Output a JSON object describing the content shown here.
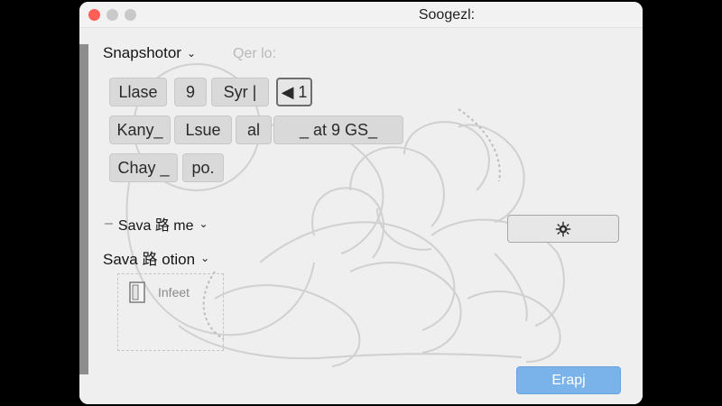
{
  "window": {
    "title": "Soogezl:"
  },
  "top": {
    "dropdown_label": "Snapshotor",
    "placeholder": "Qer lo:"
  },
  "chips": {
    "row1": [
      "Llase",
      "9",
      "Syr |",
      "◀ 1"
    ],
    "row2": [
      "Kany_",
      "Lsue",
      "al",
      "_ at 9 GS_"
    ],
    "row3": [
      "Chay _",
      "po."
    ]
  },
  "options": {
    "save_name": "Sava 路 me",
    "save_name_prefix": "–",
    "save_location": "Sava 路 otion"
  },
  "infeet": {
    "label": "Infeet"
  },
  "buttons": {
    "primary": "Erapj"
  },
  "icons": {
    "gear": "gear-icon",
    "folder": "folder-icon",
    "chevron": "chevron-down-icon"
  },
  "colors": {
    "close": "#ff5f57",
    "primary": "#7ab3ea",
    "background": "#efefef"
  }
}
